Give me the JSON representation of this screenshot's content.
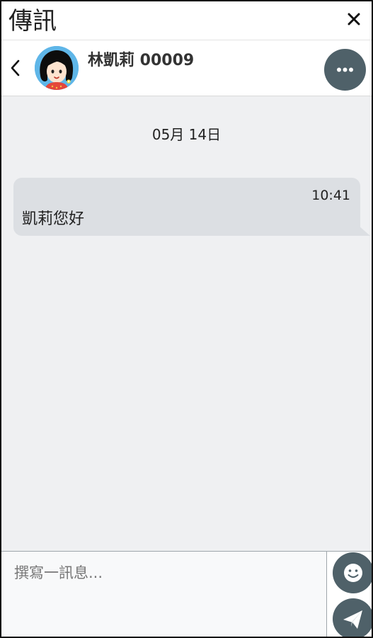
{
  "window": {
    "title": "傳訊",
    "close_icon": "close-icon"
  },
  "conversation": {
    "contact_name": "林凱莉 00009",
    "avatar_icon": "girl-avatar-icon",
    "back_icon": "chevron-left-icon",
    "more_icon": "more-dots-icon"
  },
  "chat": {
    "date_separator": "05月 14日",
    "messages": [
      {
        "time": "10:41",
        "text": "凱莉您好"
      }
    ]
  },
  "composer": {
    "placeholder": "撰寫一訊息...",
    "value": "",
    "emoji_icon": "smiley-icon",
    "send_icon": "paper-plane-icon"
  },
  "colors": {
    "accent_button": "#4f6169",
    "chat_background": "#eff0f2",
    "bubble_background": "#dcdfe3"
  }
}
